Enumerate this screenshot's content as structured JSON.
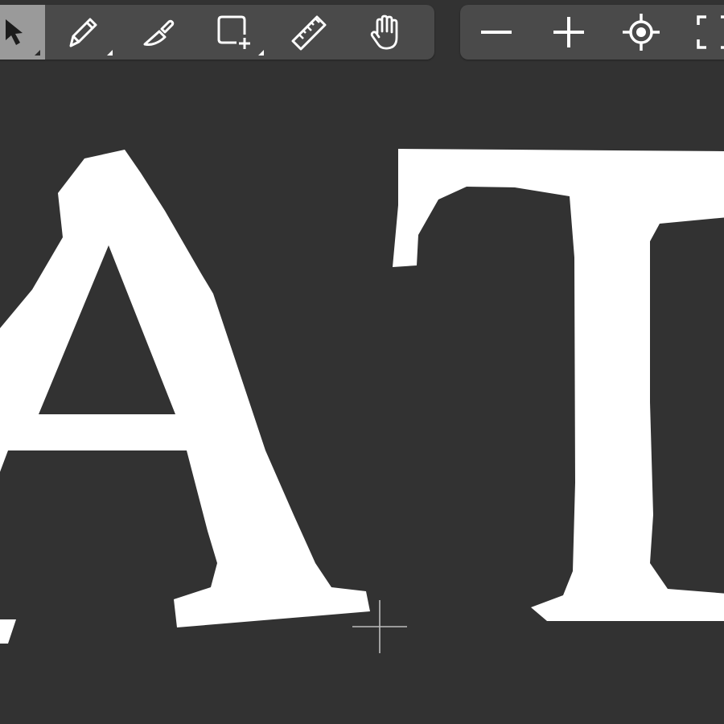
{
  "app": {
    "toolbar_tools": [
      {
        "name": "pointer-tool",
        "icon": "arrow-pointer-icon",
        "active": true,
        "has_submenu": true
      },
      {
        "name": "pencil-tool",
        "icon": "pencil-icon",
        "active": false,
        "has_submenu": true
      },
      {
        "name": "knife-tool",
        "icon": "knife-icon",
        "active": false,
        "has_submenu": false
      },
      {
        "name": "add-rectangle-tool",
        "icon": "rectangle-plus-icon",
        "active": false,
        "has_submenu": true
      },
      {
        "name": "measure-tool",
        "icon": "ruler-icon",
        "active": false,
        "has_submenu": false
      },
      {
        "name": "hand-tool",
        "icon": "hand-icon",
        "active": false,
        "has_submenu": false
      }
    ],
    "view_tools": [
      {
        "name": "zoom-out",
        "icon": "minus-icon"
      },
      {
        "name": "zoom-in",
        "icon": "plus-icon"
      },
      {
        "name": "center-view",
        "icon": "target-icon"
      },
      {
        "name": "fit-view",
        "icon": "fit-screen-icon"
      }
    ]
  },
  "canvas": {
    "glyphs": [
      "A",
      "T"
    ],
    "glyph_color": "#ffffff",
    "background_color": "#323232",
    "cursor": "crosshair-cursor"
  },
  "colors": {
    "toolbar_bg": "#4a4a4a",
    "active_tool_bg": "#9a9a9a",
    "icon": "#ffffff"
  }
}
